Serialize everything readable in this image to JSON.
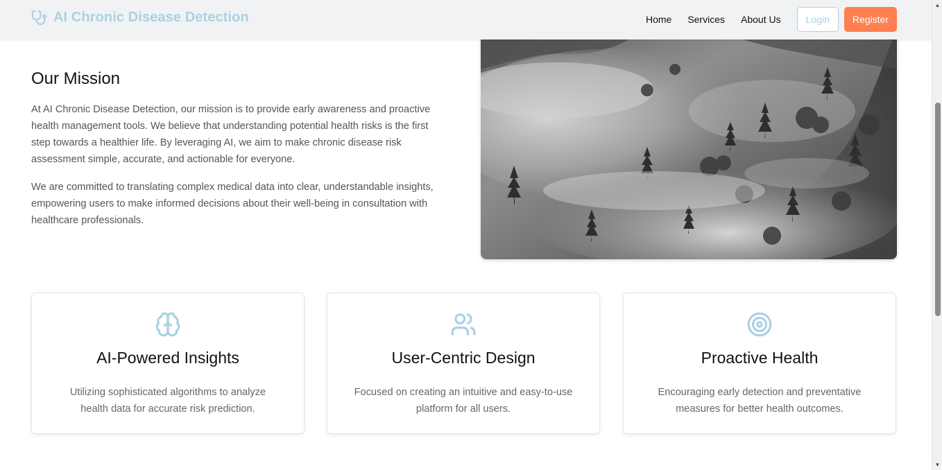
{
  "header": {
    "brand": "AI Chronic Disease Detection",
    "brand_icon": "stethoscope-icon",
    "nav": [
      {
        "label": "Home"
      },
      {
        "label": "Services"
      },
      {
        "label": "About Us"
      }
    ],
    "login_label": "Login",
    "register_label": "Register"
  },
  "mission": {
    "title": "Our Mission",
    "paragraph1": "At AI Chronic Disease Detection, our mission is to provide early awareness and proactive health management tools. We believe that understanding potential health risks is the first step towards a healthier life. By leveraging AI, we aim to make chronic disease risk assessment simple, accurate, and actionable for everyone.",
    "paragraph2": "We are committed to translating complex medical data into clear, understandable insights, empowering users to make informed decisions about their well-being in consultation with healthcare professionals."
  },
  "features": [
    {
      "icon": "brain-icon",
      "title": "AI-Powered Insights",
      "description": "Utilizing sophisticated algorithms to analyze health data for accurate risk prediction."
    },
    {
      "icon": "users-icon",
      "title": "User-Centric Design",
      "description": "Focused on creating an intuitive and easy-to-use platform for all users."
    },
    {
      "icon": "target-icon",
      "title": "Proactive Health",
      "description": "Encouraging early detection and preventative measures for better health outcomes."
    }
  ],
  "colors": {
    "brand": "#a9d2e3",
    "accent": "#ff7f50",
    "header_bg": "#f1f2f4"
  }
}
